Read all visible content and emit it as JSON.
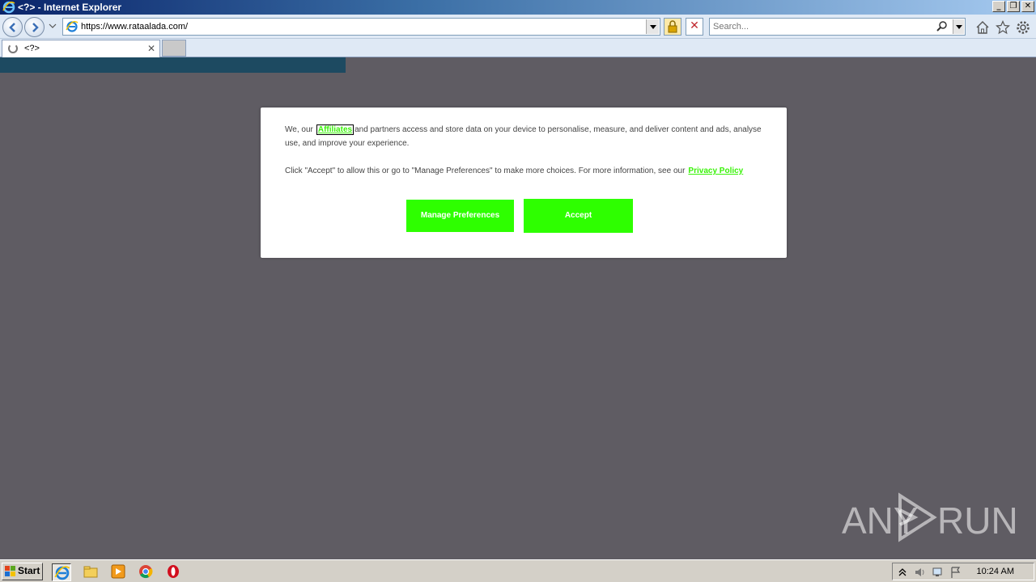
{
  "window": {
    "title": "<?> - Internet Explorer",
    "controls": [
      "minimize",
      "restore",
      "close"
    ]
  },
  "navbar": {
    "url": "https://www.rataalada.com/",
    "search_placeholder": "Search...",
    "icons": [
      "back-icon",
      "forward-icon",
      "ie-page-icon",
      "lock-icon",
      "stop-icon",
      "search-icon",
      "home-icon",
      "favorites-star-icon",
      "gear-icon"
    ]
  },
  "tabs": [
    {
      "title": "<?>",
      "loading": true
    }
  ],
  "dialog": {
    "text1_prefix": "We, our",
    "affiliates_link": "Affiliates",
    "text1_suffix": "and partners access and store data on your device to personalise, measure, and deliver content and ads, analyse use, and improve your experience.",
    "text2": "Click \"Accept\" to allow this or go to \"Manage Preferences\" to make more choices. For more information, see our",
    "privacy_link": "Privacy Policy",
    "manage_button": "Manage Preferences",
    "accept_button": "Accept",
    "accent_color": "#2eff00"
  },
  "watermark": {
    "left": "ANY",
    "right": "RUN"
  },
  "taskbar": {
    "start_label": "Start",
    "apps": [
      "internet-explorer-icon",
      "file-explorer-icon",
      "media-player-icon",
      "chrome-icon",
      "opera-icon"
    ],
    "clock": "10:24 AM"
  }
}
